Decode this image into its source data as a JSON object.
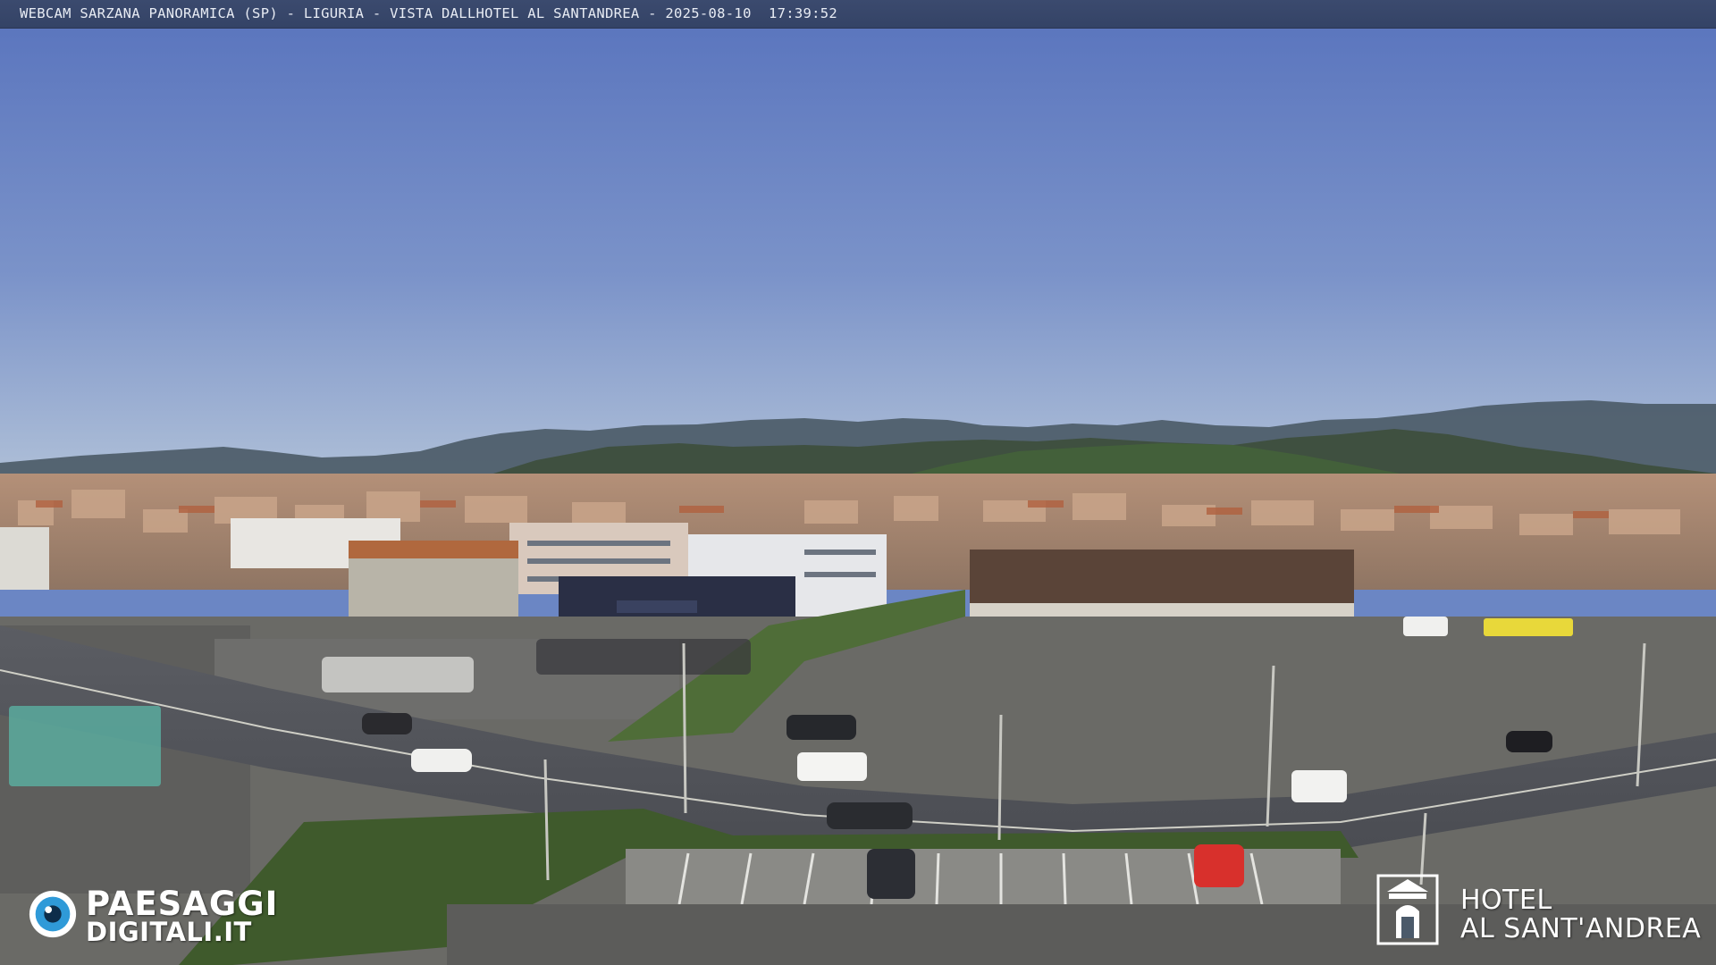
{
  "caption": {
    "text": "WEBCAM SARZANA PANORAMICA (SP) - LIGURIA - VISTA DALLHOTEL AL SANTANDREA - 2025-08-10  17:39:52"
  },
  "watermark_left": {
    "line1": "PAESAGGI",
    "line2": "DIGITALI.IT",
    "icon": "eye-logo-icon"
  },
  "watermark_right": {
    "line1": "HOTEL",
    "line2": "AL SANT'ANDREA",
    "icon": "hotel-crest-icon"
  },
  "colors": {
    "sky_top": "#5e78bf",
    "sky_bottom": "#a9bdd8",
    "caption_bar": "#3b4a6e",
    "hills": "#3c4a4c"
  }
}
